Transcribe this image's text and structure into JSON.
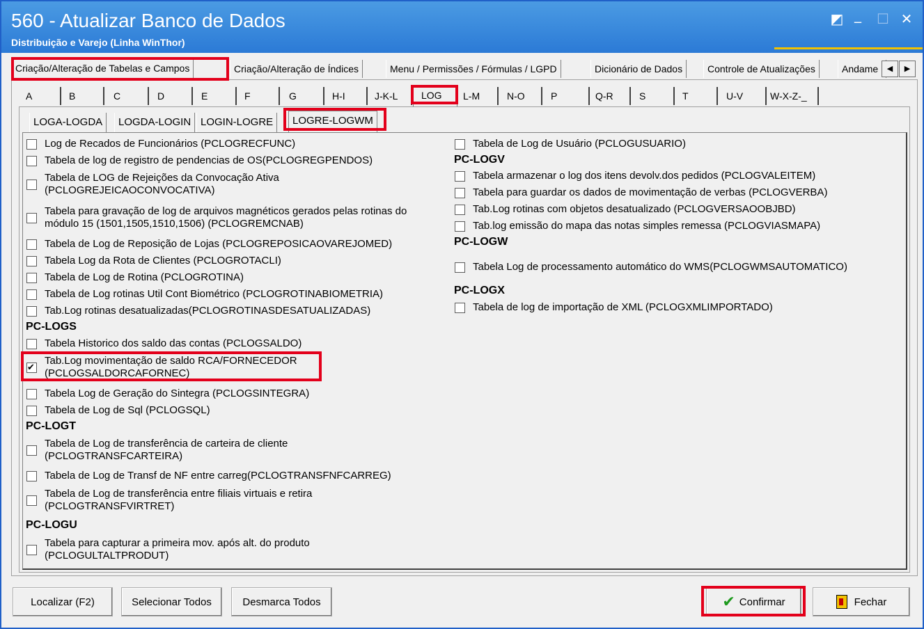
{
  "window": {
    "title": "560 - Atualizar Banco de Dados",
    "subtitle": "Distribuição e Varejo (Linha WinThor)",
    "controls": [
      "◩",
      "_",
      "☐",
      "✕"
    ]
  },
  "main_tabs": [
    "Criação/Alteração de Tabelas e Campos",
    "Criação/Alteração de Índices",
    "Menu / Permissões / Fórmulas / LGPD",
    "Dicionário de Dados",
    "Controle de Atualizações",
    "Andame"
  ],
  "letter_tabs": [
    "A",
    "B",
    "C",
    "D",
    "E",
    "F",
    "G",
    "H-I",
    "J-K-L",
    "LOG",
    "L-M",
    "N-O",
    "P",
    "Q-R",
    "S",
    "T",
    "U-V",
    "W-X-Z-_"
  ],
  "sub_tabs": [
    "LOGA-LOGDA",
    "LOGDA-LOGIN",
    "LOGIN-LOGRE",
    "LOGRE-LOGWM"
  ],
  "left_column": {
    "items_top": [
      {
        "label": "Log de Recados de Funcionários (PCLOGRECFUNC)",
        "checked": false
      },
      {
        "label": "Tabela de log de registro de pendencias de OS(PCLOGREGPENDOS)",
        "checked": false
      },
      {
        "label": "Tabela de LOG de Rejeições da Convocação Ativa",
        "label2": "(PCLOGREJEICAOCONVOCATIVA)",
        "checked": false
      },
      {
        "label": "Tabela para gravação de log de arquivos magnéticos gerados pelas rotinas do",
        "label2": "módulo 15 (1501,1505,1510,1506) (PCLOGREMCNAB)",
        "checked": false
      },
      {
        "label": "Tabela de Log de Reposição de Lojas (PCLOGREPOSICAOVAREJOMED)",
        "checked": false
      },
      {
        "label": "Tabela Log da Rota de Clientes (PCLOGROTACLI)",
        "checked": false
      },
      {
        "label": "Tabela de Log de Rotina (PCLOGROTINA)",
        "checked": false
      },
      {
        "label": "Tabela de Log rotinas Util Cont Biométrico (PCLOGROTINABIOMETRIA)",
        "checked": false
      },
      {
        "label": "Tab.Log rotinas desatualizadas(PCLOGROTINASDESATUALIZADAS)",
        "checked": false
      }
    ],
    "group_s": "PC-LOGS",
    "items_s": [
      {
        "label": "Tabela Historico dos saldo das contas (PCLOGSALDO)",
        "checked": false
      },
      {
        "label": "Tab.Log movimentação de saldo RCA/FORNECEDOR",
        "label2": "(PCLOGSALDORCAFORNEC)",
        "checked": true
      },
      {
        "label": "Tabela Log de Geração do Sintegra (PCLOGSINTEGRA)",
        "checked": false
      },
      {
        "label": "Tabela de Log de Sql (PCLOGSQL)",
        "checked": false
      }
    ],
    "group_t": "PC-LOGT",
    "items_t": [
      {
        "label": "Tabela de Log de transferência de carteira de cliente",
        "label2": "(PCLOGTRANSFCARTEIRA)",
        "checked": false
      },
      {
        "label": "Tabela de Log de Transf de NF entre carreg(PCLOGTRANSFNFCARREG)",
        "checked": false
      },
      {
        "label": "Tabela de Log de transferência entre filiais virtuais e retira",
        "label2": "(PCLOGTRANSFVIRTRET)",
        "checked": false
      }
    ],
    "group_u": "PC-LOGU",
    "items_u": [
      {
        "label": "Tabela para capturar a primeira mov. após alt. do produto",
        "label2": "(PCLOGULTALTPRODUT)",
        "checked": false
      }
    ]
  },
  "right_column": {
    "items_top": [
      {
        "label": "Tabela de Log de Usuário (PCLOGUSUARIO)",
        "checked": false
      }
    ],
    "group_v": "PC-LOGV",
    "items_v": [
      {
        "label": "Tabela armazenar o log dos itens devolv.dos pedidos (PCLOGVALEITEM)",
        "checked": false
      },
      {
        "label": "Tabela para guardar os dados de movimentação de verbas (PCLOGVERBA)",
        "checked": false
      },
      {
        "label": "Tab.Log rotinas com objetos desatualizado (PCLOGVERSAOOBJBD)",
        "checked": false
      },
      {
        "label": "Tab.log emissão do mapa das notas simples remessa (PCLOGVIASMAPA)",
        "checked": false
      }
    ],
    "group_w": "PC-LOGW",
    "items_w": [
      {
        "label": "Tabela Log de processamento automático do WMS(PCLOGWMSAUTOMATICO)",
        "checked": false
      }
    ],
    "group_x": "PC-LOGX",
    "items_x": [
      {
        "label": "Tabela de log de importação de XML (PCLOGXMLIMPORTADO)",
        "checked": false
      }
    ]
  },
  "buttons": {
    "localizar": "Localizar (F2)",
    "selecionar": "Selecionar Todos",
    "desmarca": "Desmarca Todos",
    "confirmar": "Confirmar",
    "fechar": "Fechar"
  }
}
